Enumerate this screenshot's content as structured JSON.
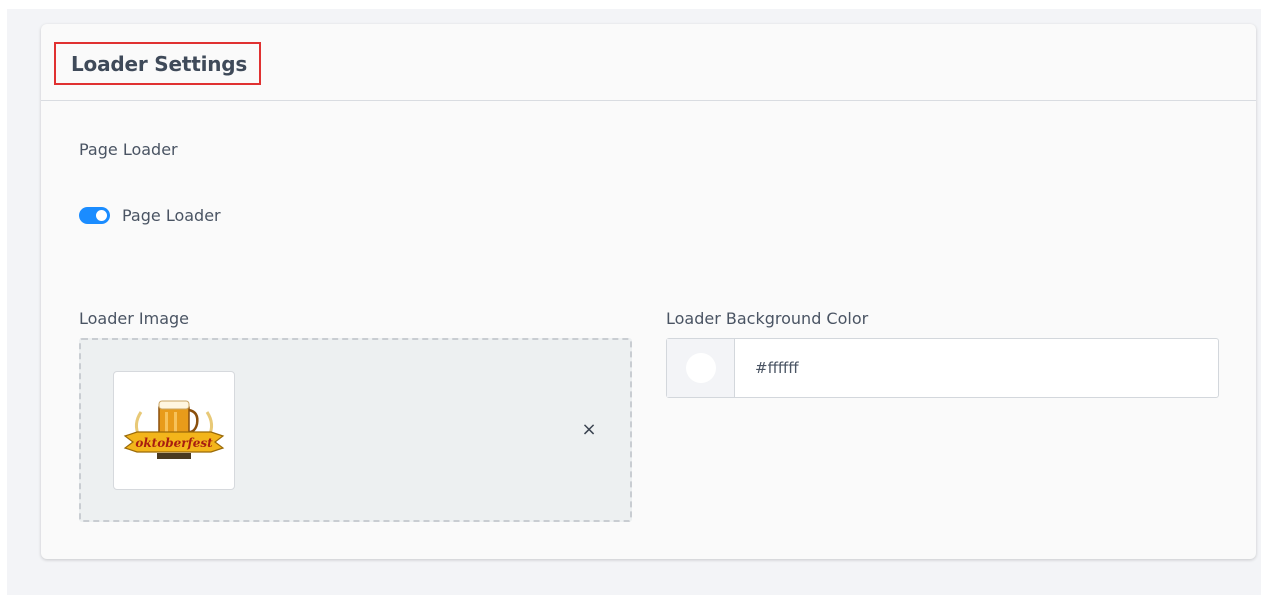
{
  "card": {
    "title": "Loader Settings"
  },
  "page_loader": {
    "section_label": "Page Loader",
    "toggle_label": "Page Loader",
    "enabled": true
  },
  "loader_image": {
    "label": "Loader Image",
    "image_text": "oktoberfest",
    "remove_symbol": "×"
  },
  "loader_bg": {
    "label": "Loader Background Color",
    "value": "#ffffff"
  },
  "colors": {
    "accent": "#1a8cff",
    "highlight_border": "#e03131"
  }
}
